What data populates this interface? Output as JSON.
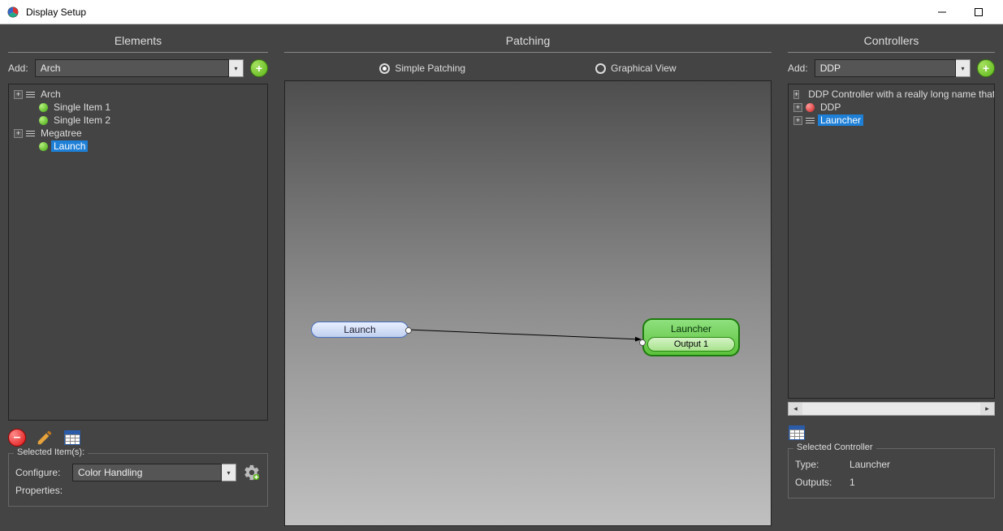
{
  "window": {
    "title": "Display Setup"
  },
  "elements_panel": {
    "title": "Elements",
    "add_label": "Add:",
    "add_value": "Arch",
    "tree": [
      {
        "label": "Arch",
        "expander": "+",
        "icon": "lines"
      },
      {
        "label": "Single Item 1",
        "expander": "",
        "icon": "green",
        "indent": 1
      },
      {
        "label": "Single Item 2",
        "expander": "",
        "icon": "green",
        "indent": 1
      },
      {
        "label": "Megatree",
        "expander": "+",
        "icon": "lines"
      },
      {
        "label": "Launch",
        "expander": "",
        "icon": "green",
        "indent": 1,
        "selected": true
      }
    ],
    "selected_group_title": "Selected Item(s):",
    "configure_label": "Configure:",
    "configure_value": "Color Handling",
    "properties_label": "Properties:"
  },
  "patching_panel": {
    "title": "Patching",
    "mode_simple": "Simple Patching",
    "mode_graphical": "Graphical View",
    "selected_mode": "Simple Patching",
    "nodes": {
      "launch": "Launch",
      "launcher": "Launcher",
      "output1": "Output 1"
    }
  },
  "controllers_panel": {
    "title": "Controllers",
    "add_label": "Add:",
    "add_value": "DDP",
    "tree": [
      {
        "label": "DDP Controller with a really long name that ",
        "expander": "+",
        "icon": "red"
      },
      {
        "label": "DDP",
        "expander": "+",
        "icon": "red"
      },
      {
        "label": "Launcher",
        "expander": "+",
        "icon": "lines",
        "selected": true
      }
    ],
    "selected_group_title": "Selected Controller",
    "type_label": "Type:",
    "type_value": "Launcher",
    "outputs_label": "Outputs:",
    "outputs_value": "1"
  }
}
